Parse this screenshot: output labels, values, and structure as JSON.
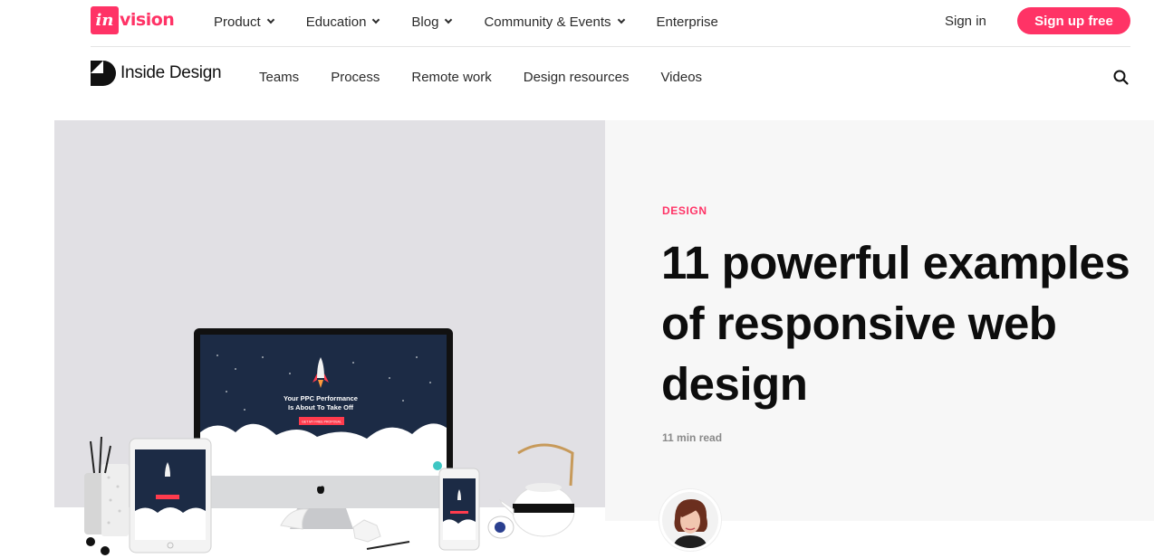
{
  "brand": {
    "logo_box": "in",
    "logo_rest": "vision",
    "accent": "#ff3366"
  },
  "top_nav": {
    "items": [
      {
        "label": "Product",
        "dropdown": true
      },
      {
        "label": "Education",
        "dropdown": true
      },
      {
        "label": "Blog",
        "dropdown": true
      },
      {
        "label": "Community & Events",
        "dropdown": true
      },
      {
        "label": "Enterprise",
        "dropdown": false
      }
    ],
    "signin": "Sign in",
    "signup": "Sign up free"
  },
  "sub_nav": {
    "logo_text": "Inside Design",
    "items": [
      "Teams",
      "Process",
      "Remote work",
      "Design resources",
      "Videos"
    ],
    "search_icon": "search-icon"
  },
  "article": {
    "category": "DESIGN",
    "title": "11 powerful examples of responsive web design",
    "read_time": "11 min read"
  },
  "hero_screen": {
    "headline_1": "Your PPC Performance",
    "headline_2": "Is About To Take Off",
    "cta": "GET MY FREE PROPOSAL"
  }
}
